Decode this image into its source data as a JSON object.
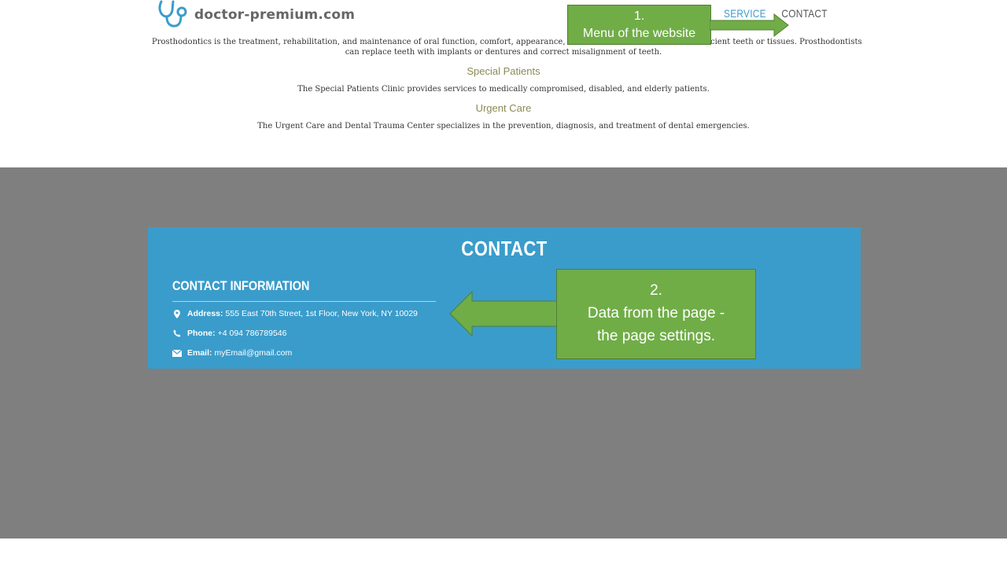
{
  "header": {
    "logo_text": "doctor-premium.com",
    "nav": {
      "service": "SERVICE",
      "contact": "CONTACT"
    }
  },
  "services": {
    "prostho_text_1": "Prosthodontics is the treatment, rehabilitation, and maintenance of oral function, comfort, appearance, and h",
    "prostho_text_1b": "cient teeth or tissues. Prosthodontists",
    "prostho_text_2": "can replace teeth with implants or dentures and correct misalignment of teeth.",
    "special_title": "Special Patients",
    "special_text": "The Special Patients Clinic provides services to medically compromised, disabled, and elderly patients.",
    "urgent_title": "Urgent Care",
    "urgent_text": "The Urgent Care and Dental Trauma Center specializes in the prevention, diagnosis, and treatment of dental emergencies."
  },
  "contact": {
    "title": "CONTACT",
    "info_title": "CONTACT INFORMATION",
    "address_label": "Address:",
    "address_value": "555 East 70th Street, 1st Floor, New York, NY 10029",
    "phone_label": "Phone:",
    "phone_value": "+4 094 786789546",
    "email_label": "Email:",
    "email_value": "myEmail@gmail.com"
  },
  "annotations": {
    "note1_num": "1.",
    "note1_text": "Menu of the website",
    "note2_num": "2.",
    "note2_line1": "Data from the page -",
    "note2_line2": "the page settings."
  },
  "colors": {
    "accent": "#3a9ccb",
    "annotation": "#70ad47",
    "background_gray": "#7f7f7f",
    "heading": "#8a8a55"
  }
}
